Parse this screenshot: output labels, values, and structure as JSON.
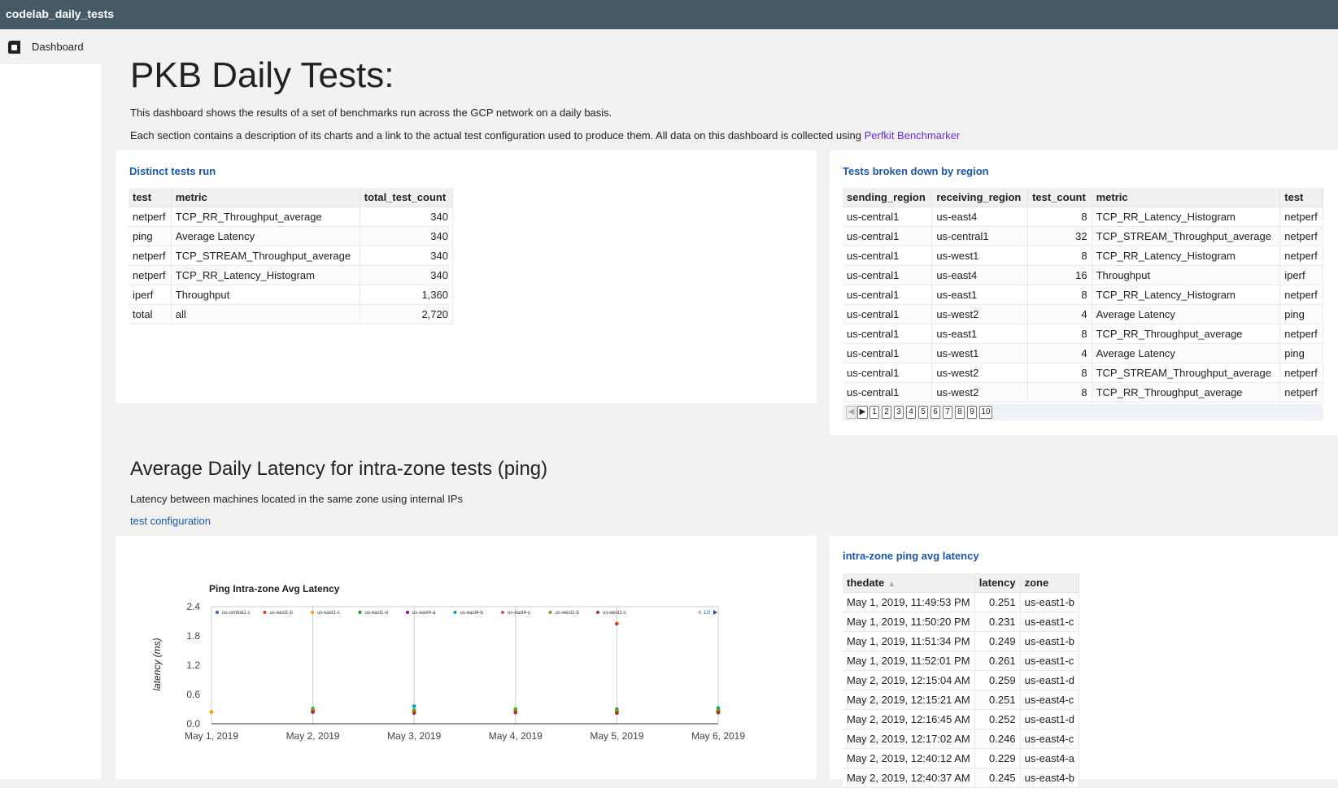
{
  "app": {
    "title": "codelab_daily_tests"
  },
  "sidebar": {
    "items": [
      {
        "label": "Dashboard",
        "icon": "dashboard-icon"
      }
    ]
  },
  "header": {
    "title": "PKB Daily Tests:",
    "description1": "This dashboard shows the results of a set of benchmarks run across the GCP network on a daily basis.",
    "description2": "Each section contains a description of its charts and a link to the actual test configuration used to produce them. All data on this dashboard is collected using ",
    "link_text": "Perfkit Benchmarker"
  },
  "distinct_tests": {
    "title": "Distinct tests run",
    "columns": [
      "test",
      "metric",
      "total_test_count"
    ],
    "rows": [
      [
        "netperf",
        "TCP_RR_Throughput_average",
        "340"
      ],
      [
        "ping",
        "Average Latency",
        "340"
      ],
      [
        "netperf",
        "TCP_STREAM_Throughput_average",
        "340"
      ],
      [
        "netperf",
        "TCP_RR_Latency_Histogram",
        "340"
      ],
      [
        "iperf",
        "Throughput",
        "1,360"
      ],
      [
        "total",
        "all",
        "2,720"
      ]
    ]
  },
  "region_tests": {
    "title": "Tests broken down by region",
    "columns": [
      "sending_region",
      "receiving_region",
      "test_count",
      "metric",
      "test"
    ],
    "rows": [
      [
        "us-central1",
        "us-east4",
        "8",
        "TCP_RR_Latency_Histogram",
        "netperf"
      ],
      [
        "us-central1",
        "us-central1",
        "32",
        "TCP_STREAM_Throughput_average",
        "netperf"
      ],
      [
        "us-central1",
        "us-west1",
        "8",
        "TCP_RR_Latency_Histogram",
        "netperf"
      ],
      [
        "us-central1",
        "us-east4",
        "16",
        "Throughput",
        "iperf"
      ],
      [
        "us-central1",
        "us-east1",
        "8",
        "TCP_RR_Latency_Histogram",
        "netperf"
      ],
      [
        "us-central1",
        "us-west2",
        "4",
        "Average Latency",
        "ping"
      ],
      [
        "us-central1",
        "us-east1",
        "8",
        "TCP_RR_Throughput_average",
        "netperf"
      ],
      [
        "us-central1",
        "us-west1",
        "4",
        "Average Latency",
        "ping"
      ],
      [
        "us-central1",
        "us-west2",
        "8",
        "TCP_STREAM_Throughput_average",
        "netperf"
      ],
      [
        "us-central1",
        "us-west2",
        "8",
        "TCP_RR_Throughput_average",
        "netperf"
      ]
    ],
    "pager": {
      "pages": [
        "1",
        "2",
        "3",
        "4",
        "5",
        "6",
        "7",
        "8",
        "9",
        "10"
      ],
      "current": "1"
    }
  },
  "section2": {
    "title": "Average Daily Latency for intra-zone tests (ping)",
    "description": "Latency between machines located in the same zone using internal IPs",
    "link": "test configuration"
  },
  "ping_table": {
    "title": "intra-zone ping avg latency",
    "columns": [
      "thedate",
      "latency",
      "zone"
    ],
    "sort_indicator": "▲",
    "rows": [
      [
        "May 1, 2019, 11:49:53 PM",
        "0.251",
        "us-east1-b"
      ],
      [
        "May 1, 2019, 11:50:20 PM",
        "0.231",
        "us-east1-c"
      ],
      [
        "May 1, 2019, 11:51:34 PM",
        "0.249",
        "us-east1-b"
      ],
      [
        "May 1, 2019, 11:52:01 PM",
        "0.261",
        "us-east1-c"
      ],
      [
        "May 2, 2019, 12:15:04 AM",
        "0.259",
        "us-east1-d"
      ],
      [
        "May 2, 2019, 12:15:21 AM",
        "0.251",
        "us-east4-c"
      ],
      [
        "May 2, 2019, 12:16:45 AM",
        "0.252",
        "us-east1-d"
      ],
      [
        "May 2, 2019, 12:17:02 AM",
        "0.246",
        "us-east4-c"
      ],
      [
        "May 2, 2019, 12:40:12 AM",
        "0.229",
        "us-east4-a"
      ],
      [
        "May 2, 2019, 12:40:37 AM",
        "0.245",
        "us-east4-b"
      ]
    ]
  },
  "chart_data": {
    "type": "scatter",
    "title": "Ping Intra-zone Avg Latency",
    "xlabel": "",
    "ylabel": "latency (ms)",
    "ylim": [
      0,
      2.4
    ],
    "yticks": [
      "2.4",
      "1.8",
      "1.2",
      "0.6",
      "0.0"
    ],
    "xticks": [
      "May 1, 2019",
      "May 2, 2019",
      "May 3, 2019",
      "May 4, 2019",
      "May 5, 2019",
      "May 6, 2019"
    ],
    "legend_page": "1/2",
    "legend_position": "top",
    "grid": true,
    "series": [
      {
        "name": "us-central1-c",
        "color": "#3366cc",
        "points": [
          [
            1,
            0.26
          ],
          [
            2,
            0.25
          ],
          [
            3,
            0.27
          ],
          [
            4,
            0.24
          ],
          [
            5,
            0.26
          ]
        ]
      },
      {
        "name": "us-east1-b",
        "color": "#dc3912",
        "points": [
          [
            1,
            0.25
          ],
          [
            2,
            0.24
          ],
          [
            3,
            0.25
          ],
          [
            4,
            2.05
          ],
          [
            5,
            0.25
          ]
        ]
      },
      {
        "name": "us-east1-c",
        "color": "#ff9900",
        "points": [
          [
            0,
            0.24
          ]
        ]
      },
      {
        "name": "us-east1-d",
        "color": "#109618",
        "points": [
          [
            1,
            0.27
          ],
          [
            2,
            0.26
          ],
          [
            3,
            0.27
          ],
          [
            4,
            0.25
          ],
          [
            5,
            0.27
          ]
        ]
      },
      {
        "name": "us-east4-a",
        "color": "#990099",
        "points": [
          [
            1,
            0.24
          ],
          [
            2,
            0.23
          ],
          [
            3,
            0.24
          ],
          [
            4,
            0.23
          ],
          [
            5,
            0.24
          ]
        ]
      },
      {
        "name": "us-east4-b",
        "color": "#0099c6",
        "points": [
          [
            1,
            0.31
          ],
          [
            2,
            0.36
          ],
          [
            3,
            0.3
          ],
          [
            4,
            0.3
          ],
          [
            5,
            0.32
          ]
        ]
      },
      {
        "name": "us-east4-c",
        "color": "#dd4477",
        "points": [
          [
            1,
            0.26
          ],
          [
            2,
            0.25
          ],
          [
            3,
            0.26
          ],
          [
            4,
            0.25
          ],
          [
            5,
            0.24
          ]
        ]
      },
      {
        "name": "us-west1-b",
        "color": "#66aa00",
        "points": [
          [
            1,
            0.29
          ],
          [
            2,
            0.28
          ],
          [
            3,
            0.29
          ],
          [
            4,
            0.28
          ],
          [
            5,
            0.29
          ]
        ]
      },
      {
        "name": "us-west1-c",
        "color": "#b82e2e",
        "points": [
          [
            1,
            0.24
          ],
          [
            2,
            0.22
          ],
          [
            3,
            0.23
          ],
          [
            4,
            0.22
          ],
          [
            5,
            0.23
          ]
        ]
      }
    ]
  }
}
